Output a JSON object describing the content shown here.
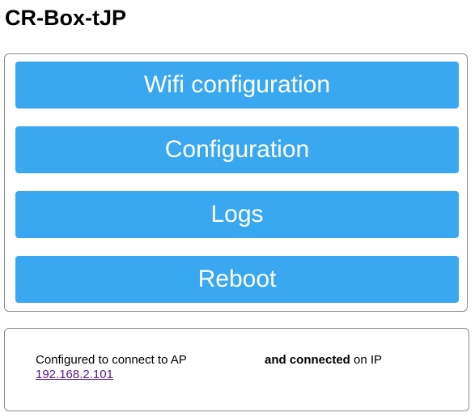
{
  "header": {
    "title": "CR-Box-tJP"
  },
  "menu": {
    "buttons": [
      {
        "label": "Wifi configuration"
      },
      {
        "label": "Configuration"
      },
      {
        "label": "Logs"
      },
      {
        "label": "Reboot"
      }
    ]
  },
  "status": {
    "configured_text": "Configured to connect to AP",
    "connected_bold": "and connected",
    "on_ip_text": "on IP",
    "ip_address": "192.168.2.101"
  },
  "colors": {
    "button_background": "#3aa8f0",
    "button_text": "#ffffff",
    "link": "#551a8b"
  }
}
